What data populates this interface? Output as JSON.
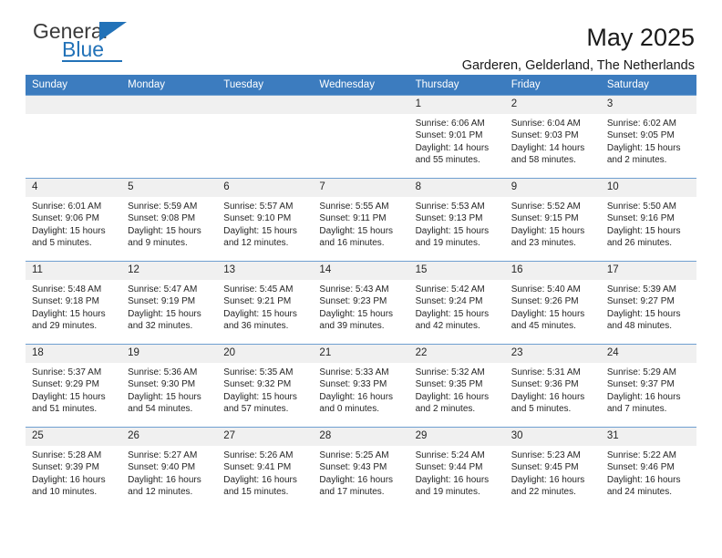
{
  "brand": {
    "name_top": "General",
    "name_bottom": "Blue",
    "accent_color": "#2272b8"
  },
  "header": {
    "title": "May 2025",
    "subtitle": "Garderen, Gelderland, The Netherlands"
  },
  "calendar": {
    "header_bg": "#3c7cbf",
    "daynum_bg": "#f0f0f0",
    "weekday_headers": [
      "Sunday",
      "Monday",
      "Tuesday",
      "Wednesday",
      "Thursday",
      "Friday",
      "Saturday"
    ],
    "weeks": [
      [
        {
          "day": "",
          "sunrise": "",
          "sunset": "",
          "daylight": "",
          "daylight2": ""
        },
        {
          "day": "",
          "sunrise": "",
          "sunset": "",
          "daylight": "",
          "daylight2": ""
        },
        {
          "day": "",
          "sunrise": "",
          "sunset": "",
          "daylight": "",
          "daylight2": ""
        },
        {
          "day": "",
          "sunrise": "",
          "sunset": "",
          "daylight": "",
          "daylight2": ""
        },
        {
          "day": "1",
          "sunrise": "Sunrise: 6:06 AM",
          "sunset": "Sunset: 9:01 PM",
          "daylight": "Daylight: 14 hours",
          "daylight2": "and 55 minutes."
        },
        {
          "day": "2",
          "sunrise": "Sunrise: 6:04 AM",
          "sunset": "Sunset: 9:03 PM",
          "daylight": "Daylight: 14 hours",
          "daylight2": "and 58 minutes."
        },
        {
          "day": "3",
          "sunrise": "Sunrise: 6:02 AM",
          "sunset": "Sunset: 9:05 PM",
          "daylight": "Daylight: 15 hours",
          "daylight2": "and 2 minutes."
        }
      ],
      [
        {
          "day": "4",
          "sunrise": "Sunrise: 6:01 AM",
          "sunset": "Sunset: 9:06 PM",
          "daylight": "Daylight: 15 hours",
          "daylight2": "and 5 minutes."
        },
        {
          "day": "5",
          "sunrise": "Sunrise: 5:59 AM",
          "sunset": "Sunset: 9:08 PM",
          "daylight": "Daylight: 15 hours",
          "daylight2": "and 9 minutes."
        },
        {
          "day": "6",
          "sunrise": "Sunrise: 5:57 AM",
          "sunset": "Sunset: 9:10 PM",
          "daylight": "Daylight: 15 hours",
          "daylight2": "and 12 minutes."
        },
        {
          "day": "7",
          "sunrise": "Sunrise: 5:55 AM",
          "sunset": "Sunset: 9:11 PM",
          "daylight": "Daylight: 15 hours",
          "daylight2": "and 16 minutes."
        },
        {
          "day": "8",
          "sunrise": "Sunrise: 5:53 AM",
          "sunset": "Sunset: 9:13 PM",
          "daylight": "Daylight: 15 hours",
          "daylight2": "and 19 minutes."
        },
        {
          "day": "9",
          "sunrise": "Sunrise: 5:52 AM",
          "sunset": "Sunset: 9:15 PM",
          "daylight": "Daylight: 15 hours",
          "daylight2": "and 23 minutes."
        },
        {
          "day": "10",
          "sunrise": "Sunrise: 5:50 AM",
          "sunset": "Sunset: 9:16 PM",
          "daylight": "Daylight: 15 hours",
          "daylight2": "and 26 minutes."
        }
      ],
      [
        {
          "day": "11",
          "sunrise": "Sunrise: 5:48 AM",
          "sunset": "Sunset: 9:18 PM",
          "daylight": "Daylight: 15 hours",
          "daylight2": "and 29 minutes."
        },
        {
          "day": "12",
          "sunrise": "Sunrise: 5:47 AM",
          "sunset": "Sunset: 9:19 PM",
          "daylight": "Daylight: 15 hours",
          "daylight2": "and 32 minutes."
        },
        {
          "day": "13",
          "sunrise": "Sunrise: 5:45 AM",
          "sunset": "Sunset: 9:21 PM",
          "daylight": "Daylight: 15 hours",
          "daylight2": "and 36 minutes."
        },
        {
          "day": "14",
          "sunrise": "Sunrise: 5:43 AM",
          "sunset": "Sunset: 9:23 PM",
          "daylight": "Daylight: 15 hours",
          "daylight2": "and 39 minutes."
        },
        {
          "day": "15",
          "sunrise": "Sunrise: 5:42 AM",
          "sunset": "Sunset: 9:24 PM",
          "daylight": "Daylight: 15 hours",
          "daylight2": "and 42 minutes."
        },
        {
          "day": "16",
          "sunrise": "Sunrise: 5:40 AM",
          "sunset": "Sunset: 9:26 PM",
          "daylight": "Daylight: 15 hours",
          "daylight2": "and 45 minutes."
        },
        {
          "day": "17",
          "sunrise": "Sunrise: 5:39 AM",
          "sunset": "Sunset: 9:27 PM",
          "daylight": "Daylight: 15 hours",
          "daylight2": "and 48 minutes."
        }
      ],
      [
        {
          "day": "18",
          "sunrise": "Sunrise: 5:37 AM",
          "sunset": "Sunset: 9:29 PM",
          "daylight": "Daylight: 15 hours",
          "daylight2": "and 51 minutes."
        },
        {
          "day": "19",
          "sunrise": "Sunrise: 5:36 AM",
          "sunset": "Sunset: 9:30 PM",
          "daylight": "Daylight: 15 hours",
          "daylight2": "and 54 minutes."
        },
        {
          "day": "20",
          "sunrise": "Sunrise: 5:35 AM",
          "sunset": "Sunset: 9:32 PM",
          "daylight": "Daylight: 15 hours",
          "daylight2": "and 57 minutes."
        },
        {
          "day": "21",
          "sunrise": "Sunrise: 5:33 AM",
          "sunset": "Sunset: 9:33 PM",
          "daylight": "Daylight: 16 hours",
          "daylight2": "and 0 minutes."
        },
        {
          "day": "22",
          "sunrise": "Sunrise: 5:32 AM",
          "sunset": "Sunset: 9:35 PM",
          "daylight": "Daylight: 16 hours",
          "daylight2": "and 2 minutes."
        },
        {
          "day": "23",
          "sunrise": "Sunrise: 5:31 AM",
          "sunset": "Sunset: 9:36 PM",
          "daylight": "Daylight: 16 hours",
          "daylight2": "and 5 minutes."
        },
        {
          "day": "24",
          "sunrise": "Sunrise: 5:29 AM",
          "sunset": "Sunset: 9:37 PM",
          "daylight": "Daylight: 16 hours",
          "daylight2": "and 7 minutes."
        }
      ],
      [
        {
          "day": "25",
          "sunrise": "Sunrise: 5:28 AM",
          "sunset": "Sunset: 9:39 PM",
          "daylight": "Daylight: 16 hours",
          "daylight2": "and 10 minutes."
        },
        {
          "day": "26",
          "sunrise": "Sunrise: 5:27 AM",
          "sunset": "Sunset: 9:40 PM",
          "daylight": "Daylight: 16 hours",
          "daylight2": "and 12 minutes."
        },
        {
          "day": "27",
          "sunrise": "Sunrise: 5:26 AM",
          "sunset": "Sunset: 9:41 PM",
          "daylight": "Daylight: 16 hours",
          "daylight2": "and 15 minutes."
        },
        {
          "day": "28",
          "sunrise": "Sunrise: 5:25 AM",
          "sunset": "Sunset: 9:43 PM",
          "daylight": "Daylight: 16 hours",
          "daylight2": "and 17 minutes."
        },
        {
          "day": "29",
          "sunrise": "Sunrise: 5:24 AM",
          "sunset": "Sunset: 9:44 PM",
          "daylight": "Daylight: 16 hours",
          "daylight2": "and 19 minutes."
        },
        {
          "day": "30",
          "sunrise": "Sunrise: 5:23 AM",
          "sunset": "Sunset: 9:45 PM",
          "daylight": "Daylight: 16 hours",
          "daylight2": "and 22 minutes."
        },
        {
          "day": "31",
          "sunrise": "Sunrise: 5:22 AM",
          "sunset": "Sunset: 9:46 PM",
          "daylight": "Daylight: 16 hours",
          "daylight2": "and 24 minutes."
        }
      ]
    ]
  }
}
